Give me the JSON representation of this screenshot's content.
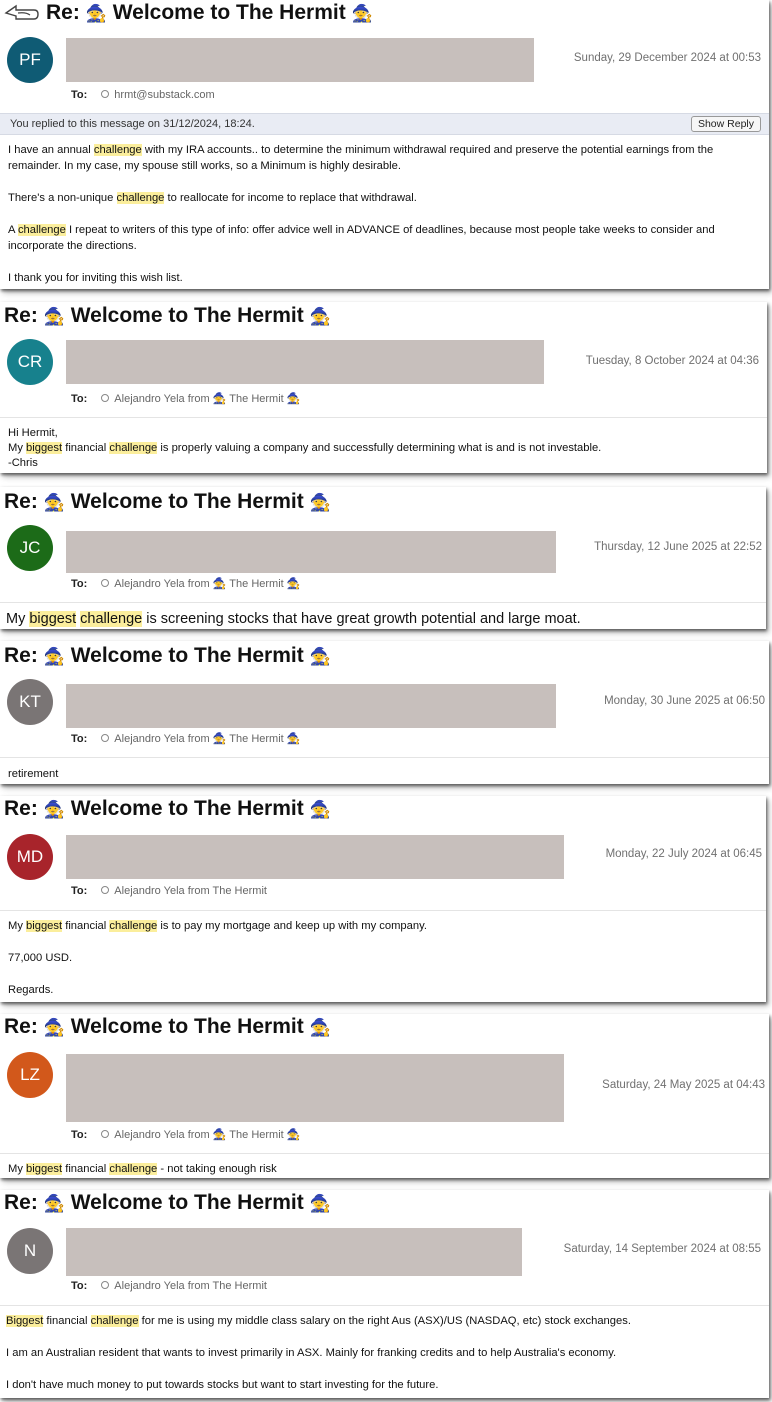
{
  "emails": [
    {
      "subject_prefix": "Re:",
      "subject_title": "Welcome to The Hermit",
      "emoji": "🧙",
      "initials": "PF",
      "avatar_color": "#0f5b74",
      "date": "Sunday, 29 December 2024 at 00:53",
      "to_label": "To:",
      "to_value": "hrmt@substack.com",
      "replied_notice": "You replied to this message on 31/12/2024, 18:24.",
      "show_reply_label": "Show Reply",
      "body": [
        [
          "I have an annual ",
          "challenge",
          " with my IRA accounts.. to determine the minimum withdrawal required and preserve the potential earnings from the remainder.  In my case,  my spouse still works,  so a Minimum is highly desirable."
        ],
        [
          "There's a non-unique ",
          "challenge",
          " to reallocate for income to replace that withdrawal."
        ],
        [
          "A ",
          "challenge",
          " I repeat to writers of this type of info:  offer advice well  in ADVANCE of deadlines,  because most people take weeks to consider and incorporate the directions."
        ],
        [
          "I thank you for inviting this wish list."
        ]
      ]
    },
    {
      "subject_prefix": "Re:",
      "subject_title": "Welcome to The Hermit",
      "emoji": "🧙",
      "initials": "CR",
      "avatar_color": "#17818d",
      "date": "Tuesday, 8 October 2024 at 04:36",
      "to_label": "To:",
      "to_value": "Alejandro Yela from 🧙 The Hermit 🧙",
      "body_lines": [
        "Hi Hermit,"
      ],
      "body_parts": [
        "My ",
        "biggest",
        " financial ",
        "challenge",
        " is properly valuing a company and successfully determining what is and is not investable."
      ],
      "signoff": "-Chris"
    },
    {
      "subject_prefix": "Re:",
      "subject_title": "Welcome to The Hermit",
      "emoji": "🧙",
      "initials": "JC",
      "avatar_color": "#1c6b18",
      "date": "Thursday, 12 June 2025 at 22:52",
      "to_label": "To:",
      "to_value": "Alejandro Yela from 🧙 The Hermit 🧙",
      "body_parts": [
        "My ",
        "biggest",
        " ",
        "challenge",
        " is screening stocks that have great growth potential and large moat."
      ]
    },
    {
      "subject_prefix": "Re:",
      "subject_title": "Welcome to The Hermit",
      "emoji": "🧙",
      "initials": "KT",
      "avatar_color": "#7a7575",
      "date": "Monday, 30 June 2025 at 06:50",
      "to_label": "To:",
      "to_value": "Alejandro Yela from 🧙 The Hermit 🧙",
      "body_text": "retirement"
    },
    {
      "subject_prefix": "Re:",
      "subject_title": "Welcome to The Hermit",
      "emoji": "🧙",
      "initials": "MD",
      "avatar_color": "#a8242b",
      "date": "Monday, 22 July 2024 at 06:45",
      "to_label": "To:",
      "to_value": "Alejandro Yela from The Hermit",
      "body_parts": [
        "My ",
        "biggest",
        " financial ",
        "challenge",
        " is to pay my mortgage and keep up with my company."
      ],
      "body_lines": [
        "77,000 USD.",
        "Regards."
      ]
    },
    {
      "subject_prefix": "Re:",
      "subject_title": "Welcome to The Hermit",
      "emoji": "🧙",
      "initials": "LZ",
      "avatar_color": "#d2581b",
      "date": "Saturday, 24 May 2025 at 04:43",
      "to_label": "To:",
      "to_value": "Alejandro Yela from 🧙 The Hermit 🧙",
      "body_parts": [
        "My ",
        "biggest",
        " financial ",
        "challenge",
        " - not taking enough risk"
      ]
    },
    {
      "subject_prefix": "Re:",
      "subject_title": "Welcome to The Hermit",
      "emoji": "🧙",
      "initials": "N",
      "avatar_color": "#7a7575",
      "date": "Saturday, 14 September 2024 at 08:55",
      "to_label": "To:",
      "to_value": "Alejandro Yela from The Hermit",
      "body_parts": [
        "",
        "Biggest",
        " financial ",
        "challenge",
        " for me is using my middle class salary on the right Aus (ASX)/US (NASDAQ, etc) stock exchanges."
      ],
      "body_lines": [
        "I am an Australian resident that wants to invest primarily in ASX. Mainly for franking credits and to help Australia's economy.",
        "I don't have much money to put towards stocks but want to start investing for the future."
      ]
    }
  ]
}
